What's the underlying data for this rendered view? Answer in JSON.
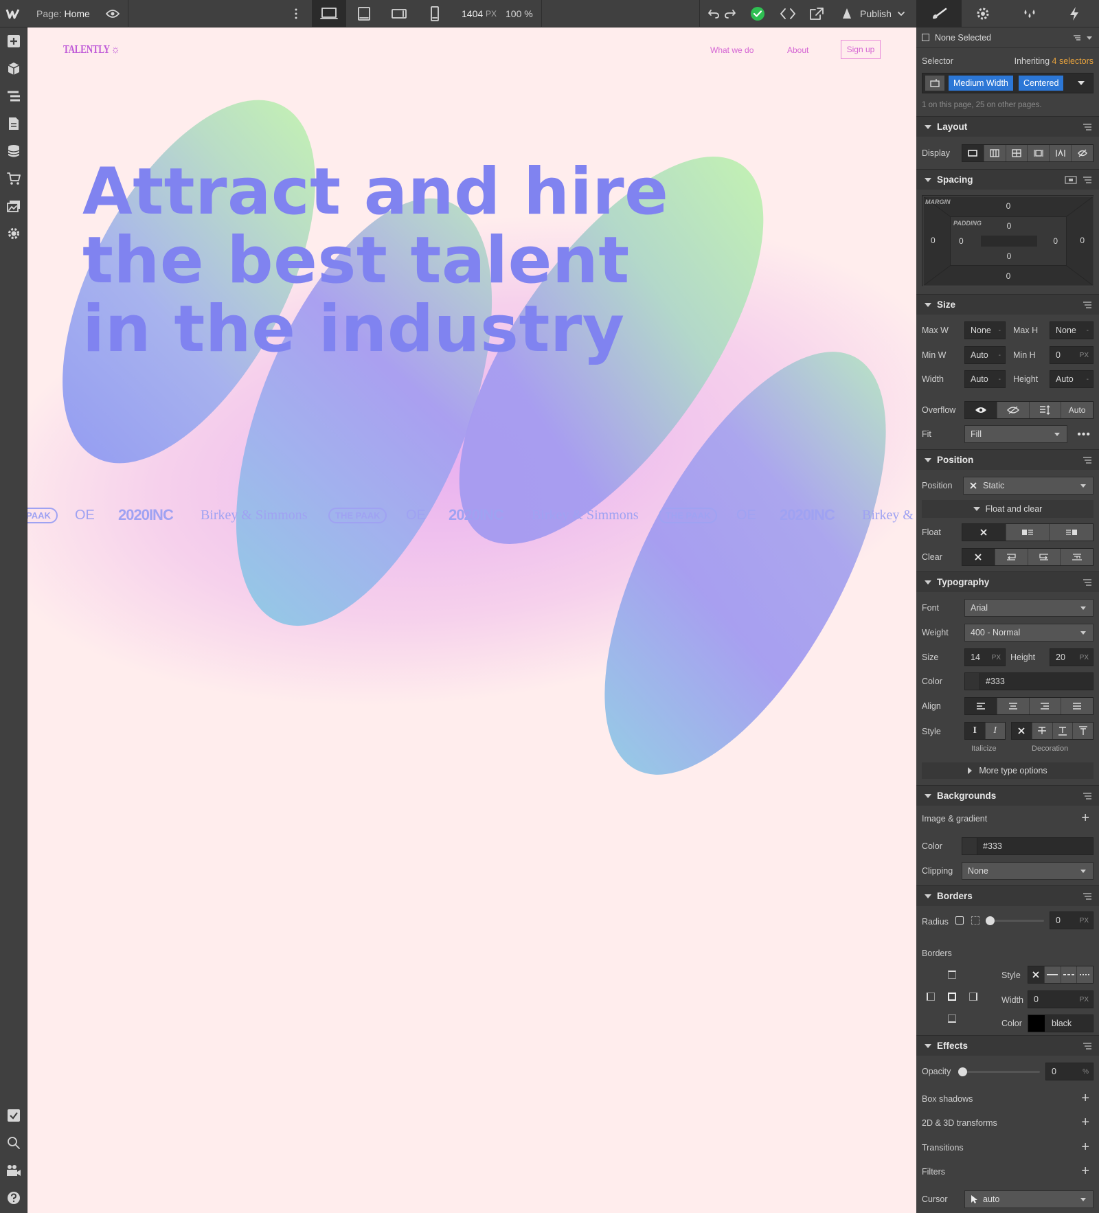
{
  "topbar": {
    "page_label": "Page:",
    "page_name": "Home",
    "width_value": "1404",
    "width_unit": "PX",
    "zoom": "100 %",
    "publish_label": "Publish"
  },
  "site": {
    "logo": "TALENTLY ☼",
    "nav": [
      "What we do",
      "About"
    ],
    "signup": "Sign up",
    "hero": "Attract and hire\nthe best talent\nin the industry",
    "logos": [
      "PAAK",
      "OE",
      "2020INC",
      "Birkey & Simmons",
      "THE PAAK",
      "OE",
      "2020INC",
      "Birkey & Simmons",
      "THE PAAK",
      "OE",
      "2020INC",
      "Birkey &"
    ],
    "blob_colors": {
      "green": "#bff5b0",
      "purple": "#a69af0",
      "blue": "#92c6e6",
      "pink": "#f4b8e6",
      "bg": "#ffeded",
      "hero": "#8083f0"
    }
  },
  "panel": {
    "none_selected": "None Selected",
    "selector_label": "Selector",
    "inheriting_prefix": "Inheriting",
    "inheriting_count": "4 selectors",
    "classes": [
      "Medium Width",
      "Centered"
    ],
    "usage": "1 on this page, 25 on other pages.",
    "layout": {
      "title": "Layout",
      "display_label": "Display"
    },
    "spacing": {
      "title": "Spacing",
      "margin_label": "MARGIN",
      "padding_label": "PADDING",
      "margin": {
        "top": "0",
        "right": "0",
        "bottom": "0",
        "left": "0"
      },
      "padding": {
        "top": "0",
        "right": "0",
        "bottom": "0",
        "left": "0"
      }
    },
    "size": {
      "title": "Size",
      "max_w_label": "Max W",
      "max_w": "None",
      "max_h_label": "Max H",
      "max_h": "None",
      "min_w_label": "Min W",
      "min_w": "Auto",
      "min_h_label": "Min H",
      "min_h": "0",
      "min_h_unit": "PX",
      "width_label": "Width",
      "width": "Auto",
      "height_label": "Height",
      "height": "Auto",
      "overflow_label": "Overflow",
      "overflow_auto": "Auto",
      "fit_label": "Fit",
      "fit": "Fill"
    },
    "position": {
      "title": "Position",
      "position_label": "Position",
      "position": "Static",
      "float_clear": "Float and clear",
      "float_label": "Float",
      "clear_label": "Clear"
    },
    "typography": {
      "title": "Typography",
      "font_label": "Font",
      "font": "Arial",
      "weight_label": "Weight",
      "weight": "400 - Normal",
      "size_label": "Size",
      "size": "14",
      "size_unit": "PX",
      "height_label": "Height",
      "height": "20",
      "height_unit": "PX",
      "color_label": "Color",
      "color": "#333",
      "align_label": "Align",
      "style_label": "Style",
      "italicize": "Italicize",
      "decoration": "Decoration",
      "more": "More type options"
    },
    "backgrounds": {
      "title": "Backgrounds",
      "image_gradient": "Image &  gradient",
      "color_label": "Color",
      "color": "#333",
      "clipping_label": "Clipping",
      "clipping": "None"
    },
    "borders": {
      "title": "Borders",
      "radius_label": "Radius",
      "radius": "0",
      "radius_unit": "PX",
      "borders_label": "Borders",
      "style_label": "Style",
      "width_label": "Width",
      "width": "0",
      "width_unit": "PX",
      "color_label": "Color",
      "color": "black"
    },
    "effects": {
      "title": "Effects",
      "opacity_label": "Opacity",
      "opacity": "0",
      "opacity_unit": "%",
      "box_shadows": "Box shadows",
      "transforms": "2D & 3D transforms",
      "transitions": "Transitions",
      "filters": "Filters",
      "cursor_label": "Cursor",
      "cursor": "auto"
    }
  }
}
